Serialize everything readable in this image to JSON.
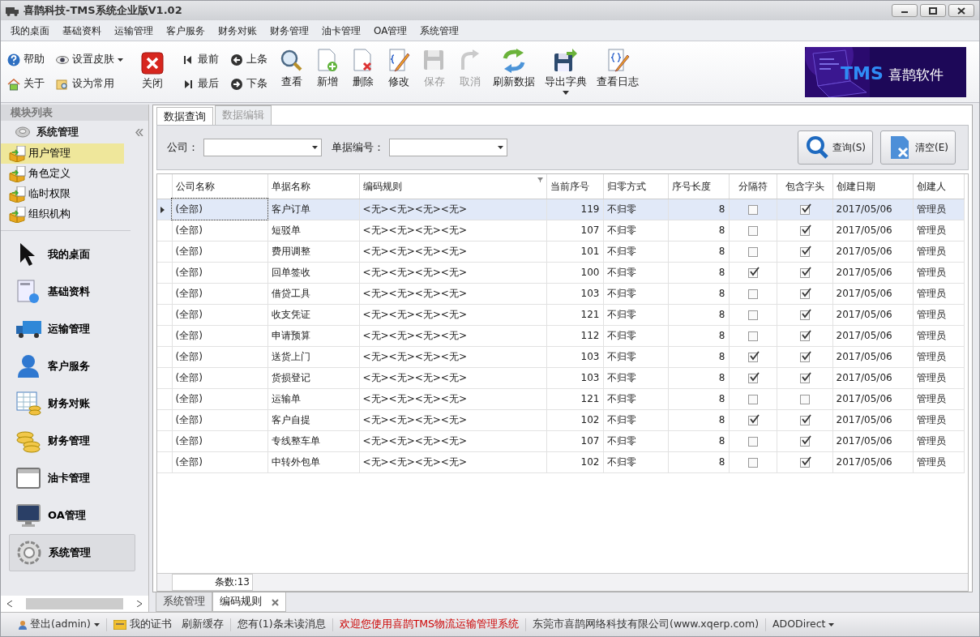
{
  "window": {
    "title": "喜鹊科技-TMS系统企业版V1.02"
  },
  "menu": [
    "我的桌面",
    "基础资料",
    "运输管理",
    "客户服务",
    "财务对账",
    "财务管理",
    "油卡管理",
    "OA管理",
    "系统管理"
  ],
  "toolbar": {
    "small_left": [
      {
        "label": "帮助",
        "dropdown": false
      },
      {
        "label": "关于",
        "dropdown": false
      },
      {
        "label": "设置皮肤",
        "dropdown": true
      },
      {
        "label": "设为常用",
        "dropdown": false
      }
    ],
    "close": {
      "label": "关闭"
    },
    "nav": [
      {
        "label": "最前"
      },
      {
        "label": "最后"
      },
      {
        "label": "上条"
      },
      {
        "label": "下条"
      }
    ],
    "buttons": [
      {
        "label": "查看",
        "disabled": false,
        "dropdown": false
      },
      {
        "label": "新增",
        "disabled": false,
        "dropdown": false
      },
      {
        "label": "删除",
        "disabled": false,
        "dropdown": false
      },
      {
        "label": "修改",
        "disabled": false,
        "dropdown": false
      },
      {
        "label": "保存",
        "disabled": true,
        "dropdown": false
      },
      {
        "label": "取消",
        "disabled": true,
        "dropdown": false
      },
      {
        "label": "刷新数据",
        "disabled": false,
        "dropdown": false
      },
      {
        "label": "导出字典",
        "disabled": false,
        "dropdown": true
      },
      {
        "label": "查看日志",
        "disabled": false,
        "dropdown": false
      }
    ]
  },
  "banner": {
    "brand": "TMS",
    "text": "喜鹊软件"
  },
  "sidebar": {
    "header": "模块列表",
    "group": "系统管理",
    "items": [
      {
        "label": "用户管理",
        "selected": true
      },
      {
        "label": "角色定义",
        "selected": false
      },
      {
        "label": "临时权限",
        "selected": false
      },
      {
        "label": "组织机构",
        "selected": false
      }
    ],
    "modules": [
      {
        "label": "我的桌面",
        "selected": false
      },
      {
        "label": "基础资料",
        "selected": false
      },
      {
        "label": "运输管理",
        "selected": false
      },
      {
        "label": "客户服务",
        "selected": false
      },
      {
        "label": "财务对账",
        "selected": false
      },
      {
        "label": "财务管理",
        "selected": false
      },
      {
        "label": "油卡管理",
        "selected": false
      },
      {
        "label": "OA管理",
        "selected": false
      },
      {
        "label": "系统管理",
        "selected": true
      }
    ]
  },
  "tabs": [
    {
      "label": "数据查询",
      "selected": true
    },
    {
      "label": "数据编辑",
      "selected": false
    }
  ],
  "filters": [
    {
      "label": "公司："
    },
    {
      "label": "单据编号："
    }
  ],
  "actions": [
    {
      "label": "查询(S)"
    },
    {
      "label": "清空(E)"
    }
  ],
  "table": {
    "columns": [
      "公司名称",
      "单据名称",
      "编码规则",
      "当前序号",
      "归零方式",
      "序号长度",
      "分隔符",
      "包含字头",
      "创建日期",
      "创建人"
    ],
    "rows": [
      {
        "company": "(全部)",
        "name": "客户订单",
        "rule": "<无><无><无><无>",
        "seq": "119",
        "reset": "不归零",
        "length": "8",
        "separator": false,
        "prefix": true,
        "date": "2017/05/06",
        "creator": "管理员",
        "selected": true
      },
      {
        "company": "(全部)",
        "name": "短驳单",
        "rule": "<无><无><无><无>",
        "seq": "107",
        "reset": "不归零",
        "length": "8",
        "separator": false,
        "prefix": true,
        "date": "2017/05/06",
        "creator": "管理员",
        "selected": false
      },
      {
        "company": "(全部)",
        "name": "费用调整",
        "rule": "<无><无><无><无>",
        "seq": "101",
        "reset": "不归零",
        "length": "8",
        "separator": false,
        "prefix": true,
        "date": "2017/05/06",
        "creator": "管理员",
        "selected": false
      },
      {
        "company": "(全部)",
        "name": "回单签收",
        "rule": "<无><无><无><无>",
        "seq": "100",
        "reset": "不归零",
        "length": "8",
        "separator": true,
        "prefix": true,
        "date": "2017/05/06",
        "creator": "管理员",
        "selected": false
      },
      {
        "company": "(全部)",
        "name": "借贷工具",
        "rule": "<无><无><无><无>",
        "seq": "103",
        "reset": "不归零",
        "length": "8",
        "separator": false,
        "prefix": true,
        "date": "2017/05/06",
        "creator": "管理员",
        "selected": false
      },
      {
        "company": "(全部)",
        "name": "收支凭证",
        "rule": "<无><无><无><无>",
        "seq": "121",
        "reset": "不归零",
        "length": "8",
        "separator": false,
        "prefix": true,
        "date": "2017/05/06",
        "creator": "管理员",
        "selected": false
      },
      {
        "company": "(全部)",
        "name": "申请预算",
        "rule": "<无><无><无><无>",
        "seq": "112",
        "reset": "不归零",
        "length": "8",
        "separator": false,
        "prefix": true,
        "date": "2017/05/06",
        "creator": "管理员",
        "selected": false
      },
      {
        "company": "(全部)",
        "name": "送货上门",
        "rule": "<无><无><无><无>",
        "seq": "103",
        "reset": "不归零",
        "length": "8",
        "separator": true,
        "prefix": true,
        "date": "2017/05/06",
        "creator": "管理员",
        "selected": false
      },
      {
        "company": "(全部)",
        "name": "货损登记",
        "rule": "<无><无><无><无>",
        "seq": "103",
        "reset": "不归零",
        "length": "8",
        "separator": true,
        "prefix": true,
        "date": "2017/05/06",
        "creator": "管理员",
        "selected": false
      },
      {
        "company": "(全部)",
        "name": "运输单",
        "rule": "<无><无><无><无>",
        "seq": "121",
        "reset": "不归零",
        "length": "8",
        "separator": false,
        "prefix": false,
        "date": "2017/05/06",
        "creator": "管理员",
        "selected": false
      },
      {
        "company": "(全部)",
        "name": "客户自提",
        "rule": "<无><无><无><无>",
        "seq": "102",
        "reset": "不归零",
        "length": "8",
        "separator": true,
        "prefix": true,
        "date": "2017/05/06",
        "creator": "管理员",
        "selected": false
      },
      {
        "company": "(全部)",
        "name": "专线整车单",
        "rule": "<无><无><无><无>",
        "seq": "107",
        "reset": "不归零",
        "length": "8",
        "separator": false,
        "prefix": true,
        "date": "2017/05/06",
        "creator": "管理员",
        "selected": false
      },
      {
        "company": "(全部)",
        "name": "中转外包单",
        "rule": "<无><无><无><无>",
        "seq": "102",
        "reset": "不归零",
        "length": "8",
        "separator": false,
        "prefix": true,
        "date": "2017/05/06",
        "creator": "管理员",
        "selected": false
      }
    ]
  },
  "footer": {
    "count": "条数:13"
  },
  "doc_tabs": [
    {
      "label": "系统管理",
      "selected": false,
      "closable": false
    },
    {
      "label": "编码规则",
      "selected": true,
      "closable": true
    }
  ],
  "status_bar": [
    {
      "kind": "user",
      "label": "登出(admin)"
    },
    {
      "kind": "cert",
      "label": "我的证书"
    },
    {
      "kind": "plain",
      "label": "刷新缓存"
    },
    {
      "kind": "plain",
      "label": "您有(1)条未读消息"
    },
    {
      "kind": "notice",
      "label": "欢迎您使用喜鹊TMS物流运输管理系统"
    },
    {
      "kind": "plain",
      "label": "东莞市喜鹊网络科技有限公司(www.xqerp.com)"
    },
    {
      "kind": "menu",
      "label": "ADODirect"
    }
  ]
}
